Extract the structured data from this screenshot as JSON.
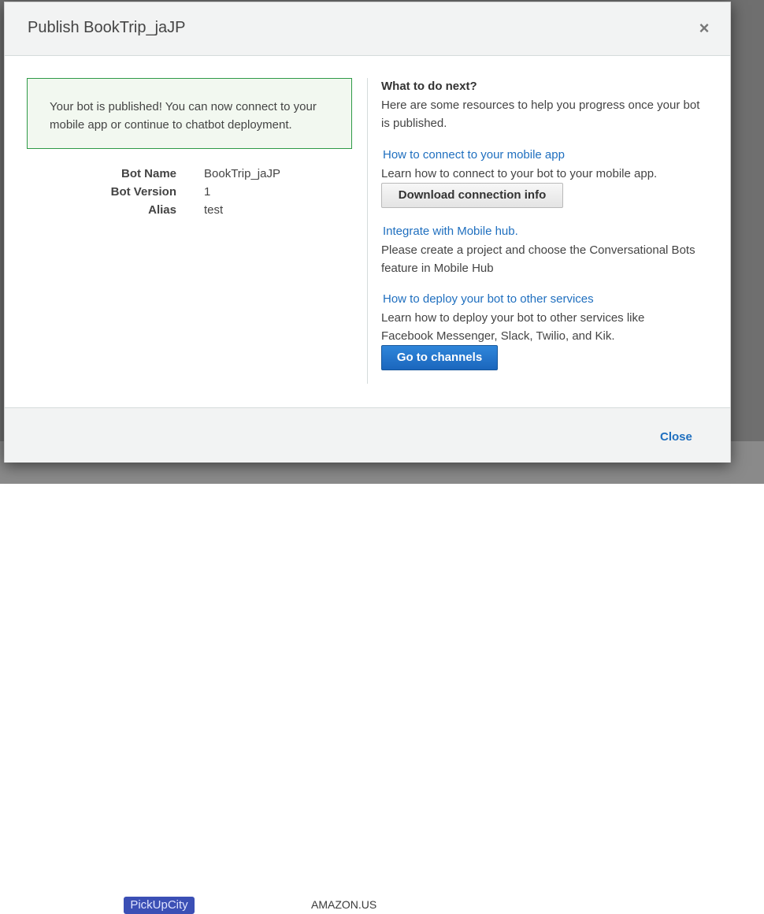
{
  "modal": {
    "title": "Publish BookTrip_jaJP",
    "close_icon": "close-icon",
    "success_message": "Your bot is published! You can now connect to your mobile app or continue to chatbot deployment.",
    "details": [
      {
        "key": "Bot Name",
        "value": "BookTrip_jaJP"
      },
      {
        "key": "Bot Version",
        "value": "1"
      },
      {
        "key": "Alias",
        "value": "test"
      }
    ],
    "next": {
      "heading": "What to do next?",
      "intro": "Here are some resources to help you progress once your bot is published.",
      "sections": [
        {
          "link": "How to connect to your mobile app",
          "text": "Learn how to connect to your bot to your mobile app.",
          "button": "Download connection info"
        },
        {
          "link": "Integrate with Mobile hub.",
          "text": "Please create a project and choose the Conversational Bots feature in Mobile Hub"
        },
        {
          "link": "How to deploy your bot to other services",
          "text": "Learn how to deploy your bot to other services like Facebook Messenger, Slack, Twilio, and Kik.",
          "button": "Go to channels"
        }
      ]
    },
    "footer": {
      "close_label": "Close"
    }
  },
  "background": {
    "chip": "PickUpCity",
    "text": "AMAZON.US"
  },
  "colors": {
    "link": "#1f6fbf",
    "primary_button": "#1b66bd",
    "success_border": "#2e9a47",
    "success_bg": "#f2f8f0"
  }
}
